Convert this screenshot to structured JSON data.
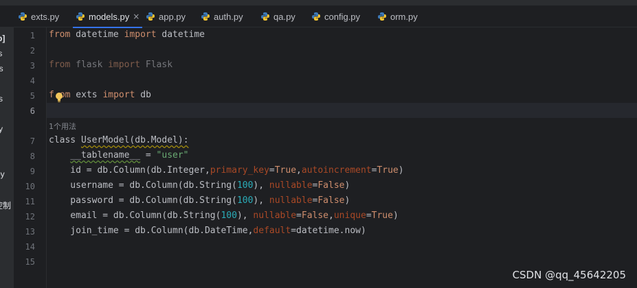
{
  "tabs": [
    {
      "label": "exts.py"
    },
    {
      "label": "models.py",
      "close": "×"
    },
    {
      "label": "app.py"
    },
    {
      "label": "auth.py"
    },
    {
      "label": "qa.py"
    },
    {
      "label": "config.py"
    },
    {
      "label": "orm.py"
    }
  ],
  "left_panel": [
    "p]",
    "ts",
    "ns",
    "s",
    "y",
    "py",
    "控制"
  ],
  "line_numbers": [
    "1",
    "2",
    "3",
    "4",
    "5",
    "6",
    "7",
    "8",
    "9",
    "10",
    "11",
    "12",
    "13",
    "14",
    "15"
  ],
  "code": {
    "l1": {
      "kw1": "from",
      "t1": " datetime ",
      "kw2": "import",
      "t2": " datetime"
    },
    "l3": {
      "kw1": "from",
      "t1": " flask ",
      "kw2": "import",
      "t2": " Flask"
    },
    "l5": {
      "kw1a": "f",
      "kw1b": "om",
      "t1": " exts ",
      "kw2": "import",
      "t2": " db"
    },
    "usage_hint": "1个用法",
    "l7": {
      "kw": "class",
      "t1": " ",
      "cls": "UserModel",
      "t2": "(db.Model):"
    },
    "l8": {
      "indent": "    ",
      "dunder": "__tablename__",
      "t1": " = ",
      "str": "\"user\""
    },
    "l9": {
      "t1": "    id = db.Column(db.Integer",
      "sep1": ",",
      "p1": "primary_key",
      "eq1": "=",
      "kw1": "True",
      "sep2": ",",
      "p2": "autoincrement",
      "eq2": "=",
      "kw2": "True",
      "t2": ")"
    },
    "l10": {
      "t1": "    username = db.Column(db.String(",
      "num": "100",
      "t2": "), ",
      "p": "nullable",
      "eq": "=",
      "kw": "False",
      "t3": ")"
    },
    "l11": {
      "t1": "    password = db.Column(db.String(",
      "num": "100",
      "t2": "), ",
      "p": "nullable",
      "eq": "=",
      "kw": "False",
      "t3": ")"
    },
    "l12": {
      "t1": "    email = db.Column(db.String(",
      "num": "100",
      "t2": "), ",
      "p1": "nullable",
      "eq1": "=",
      "kw1": "False",
      "sep": ",",
      "p2": "unique",
      "eq2": "=",
      "kw2": "True",
      "t3": ")"
    },
    "l13": {
      "t1": "    join_time = db.Column(db.DateTime",
      "sep": ",",
      "p": "default",
      "eq": "=",
      "t2": "datetime.now)"
    }
  },
  "watermark": "CSDN @qq_45642205",
  "colors": {
    "background": "#1e1f22",
    "keyword": "#cf8e6d",
    "string": "#6aab73",
    "number": "#2aacb8",
    "param": "#aa4926",
    "accent": "#3574f0"
  }
}
